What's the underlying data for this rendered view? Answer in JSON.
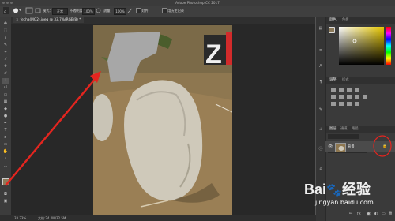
{
  "window": {
    "title": "Adobe Photoshop CC 2017"
  },
  "options_bar": {
    "tool_label": "模式：",
    "mode_value": "正常",
    "opacity_label": "不透明度：",
    "opacity_value": "100%",
    "flow_label": "流量：",
    "flow_value": "100%",
    "sample_label": "对齐",
    "history_label": "用历史记录"
  },
  "document": {
    "tab_label": "file(2).jpeg @ 33.3%(RGB/8)",
    "tab_label_raw": "fecha(MG2).jpeg @ 33.7%(RGB/8) *"
  },
  "status": {
    "zoom": "33.33%",
    "doc_info": "文档:24.2M/32.5M"
  },
  "panels": {
    "color_tab": "颜色",
    "swatches_tab": "色板",
    "adjust_tab": "调整",
    "styles_tab": "样式",
    "layers_tab": "图层",
    "channels_tab": "通道",
    "paths_tab": "路径",
    "layer_name": "背景",
    "fg_color": "#8c7a5a",
    "bg_color": "#ffffff"
  },
  "watermark": {
    "brand": "Bai",
    "brand2": "经验",
    "url": "jingyan.baidu.com"
  },
  "colors": {
    "annotation_red": "#e3251f"
  }
}
